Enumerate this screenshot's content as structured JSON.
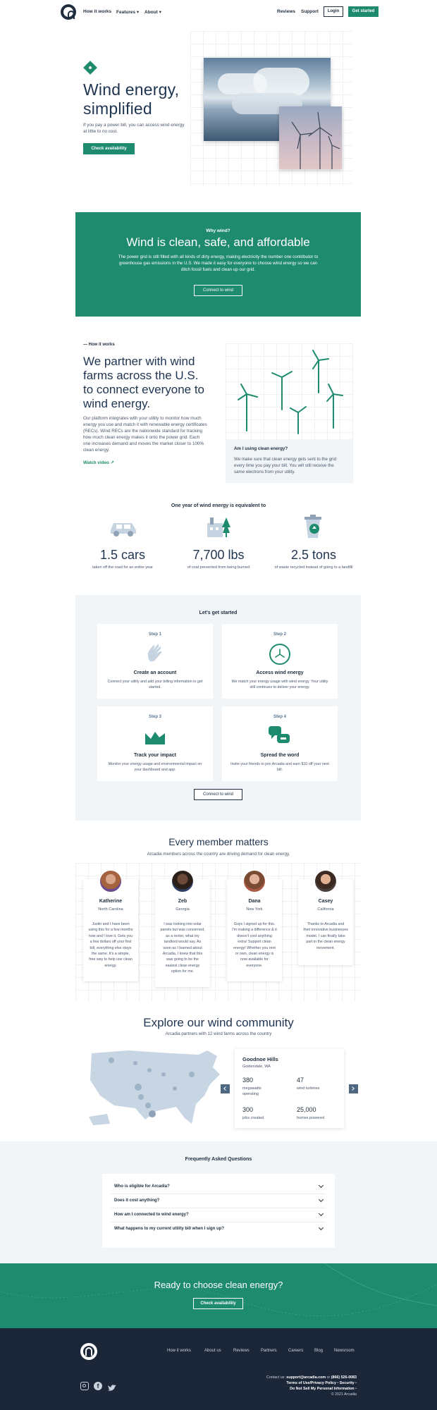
{
  "nav": {
    "links": [
      "How it works",
      "Features ▾",
      "About ▾"
    ],
    "right_links": [
      "Reviews",
      "Support"
    ],
    "login": "Login",
    "cta": "Get started"
  },
  "hero": {
    "title_line1": "Wind energy,",
    "title_line2": "simplified",
    "subtitle": "If you pay a power bill, you can access wind energy at little to no cost.",
    "cta": "Check availability"
  },
  "why": {
    "eyebrow": "Why wind?",
    "title": "Wind is clean, safe, and affordable",
    "body": "The power grid is still filled with all kinds of dirty energy, making electricity the number one contributor to greenhouse gas emissions in the U.S. We made it easy for everyone to choose wind energy so we can ditch fossil fuels and clean up our grid.",
    "cta": "Connect to wind"
  },
  "how": {
    "eyebrow": "— How it works",
    "title": "We partner with wind farms across the U.S. to connect everyone to wind energy.",
    "body": "Our platform integrates with your utility to monitor how much energy you use and match it with renewable energy certificates (RECs). Wind RECs are the nationwide standard for tracking how much clean energy makes it onto the power grid. Each one increases demand and moves the market closer to 100% clean energy.",
    "video": "Watch video",
    "faq_title": "Am I using clean energy?",
    "faq_body": "We make sure that clean energy gets sent to the grid every time you pay your bill. You will still receive the same electrons from your utility."
  },
  "stats": {
    "title": "One year of wind energy is equivalent to",
    "items": [
      {
        "value": "1.5 cars",
        "label": "taken off the road for an entire year",
        "icon": "car-icon"
      },
      {
        "value": "7,700 lbs",
        "label": "of coal prevented from being burned",
        "icon": "factory-icon"
      },
      {
        "value": "2.5 tons",
        "label": "of waste recycled instead of going to a landfill",
        "icon": "recycle-icon"
      }
    ]
  },
  "steps": {
    "title": "Let's get started",
    "items": [
      {
        "step": "Step 1",
        "title": "Create an account",
        "desc": "Connect your utility and add your billing information to get started.",
        "icon": "wave-hand-icon"
      },
      {
        "step": "Step 2",
        "title": "Access wind energy",
        "desc": "We match your energy usage with wind energy. Your utility still continues to deliver your energy.",
        "icon": "turbine-circle-icon"
      },
      {
        "step": "Step 3",
        "title": "Track your impact",
        "desc": "Monitor your energy usage and environmental impact on your dashboard and app.",
        "icon": "chart-icon"
      },
      {
        "step": "Step 4",
        "title": "Spread the word",
        "desc": "Invite your friends to join Arcadia and earn $10 off your next bill.",
        "icon": "chat-icon"
      }
    ],
    "cta": "Connect to wind"
  },
  "members": {
    "title": "Every member matters",
    "subtitle": "Arcadia members across the country are driving demand for clean energy.",
    "items": [
      {
        "name": "Katherine",
        "location": "North Carolina",
        "quote": "Justin and I have been using this for a few months now and I love it. Gets you a few dollars off your first bill, everything else stays the same. It's a simple, free way to help use clean energy."
      },
      {
        "name": "Zeb",
        "location": "Georgia",
        "quote": "I was looking into solar panels but was concerned, as a renter, what my landlord would say. As soon as I learned about Arcadia, I knew that this was going to be the easiest clean energy option for me."
      },
      {
        "name": "Dana",
        "location": "New York",
        "quote": "Guys I signed up for this. I'm making a difference & it doesn't cost anything extra! Support clean energy! Whether you rent or own, clean energy is now available for everyone."
      },
      {
        "name": "Casey",
        "location": "California",
        "quote": "Thanks to Arcadia and their innovative businesses model, I can finally take part in the clean energy movement."
      }
    ]
  },
  "community": {
    "title": "Explore our wind community",
    "subtitle": "Arcadia partners with 12 wind farms across the country",
    "farm_name": "Goodnoe Hills",
    "farm_location": "Goldendale, WA",
    "stats": [
      {
        "value": "380",
        "label": "megawatts operating"
      },
      {
        "value": "47",
        "label": "wind turbines"
      },
      {
        "value": "300",
        "label": "jobs created"
      },
      {
        "value": "25,000",
        "label": "homes powered"
      }
    ]
  },
  "faq": {
    "title": "Frequently Asked Questions",
    "items": [
      "Who is eligible for Arcadia?",
      "Does it cost anything?",
      "How am I connected to wind energy?",
      "What happens to my current utility bill when I sign up?"
    ]
  },
  "cta_band": {
    "title": "Ready to choose clean energy?",
    "cta": "Check availability"
  },
  "footer": {
    "links": [
      "How it works",
      "About us",
      "Reviews",
      "Partners",
      "Careers",
      "Blog",
      "Newsroom"
    ],
    "contact_prefix": "Contact us:",
    "email": "support@arcadia.com",
    "or": "or",
    "phone": "(866) 526-0083",
    "legal1": "Terms of Use/Privacy Policy",
    "legal2": "Security",
    "legal3": "Do Not Sell My Personal Information",
    "copyright": "© 2021 Arcadia"
  },
  "colors": {
    "brand_green": "#1e8a6e",
    "navy": "#1f2d3d",
    "footer_bg": "#1b2638",
    "light_bg": "#f4f7f9"
  }
}
